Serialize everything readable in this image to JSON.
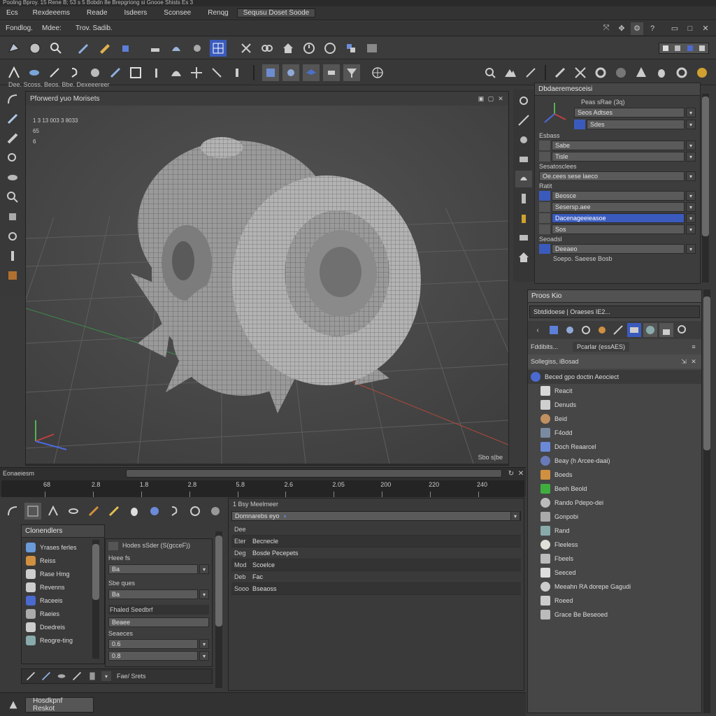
{
  "titlebar": {
    "text": "Pooling Bproy. 15 Rene B; 53 s 5 Bobdn 8e Brepgriong si Gnooe Shists Es 3"
  },
  "menubar": [
    "Ecs",
    "Rexdeeems",
    "Reade",
    "Isdeers",
    "Sconsee",
    "Renqg",
    "Sequsu Doset Soode"
  ],
  "breadcrumb": [
    "Fondlog.",
    "Mdee:",
    "Trov. Sadib."
  ],
  "toolbar_hint": "Dee. Scoss. Beos. Bbe. Dexeeereer",
  "viewport": {
    "title": "Pforwerd yuo Morisets",
    "stats": [
      "1 3 13 003 3 8033",
      "65",
      "6"
    ],
    "footer": "Sbo s|be"
  },
  "timeline": {
    "label": "Eonaeiesm",
    "ticks": [
      "68",
      "2.8",
      "1.8",
      "2.8",
      "5.8",
      "2.6",
      "2.05",
      "200",
      "220",
      "240"
    ]
  },
  "props_panel": {
    "title": "Dbdaeremesceisi",
    "header_label": "Peas sRae (3q)",
    "rows": [
      {
        "label": "Seos Adtses",
        "value": ""
      },
      {
        "label": "Sdes",
        "value": ""
      },
      {
        "label": "Esbass",
        "value": ""
      },
      {
        "label": "Sabe",
        "value": ""
      },
      {
        "label": "Tisle",
        "value": ""
      },
      {
        "label": "Sesatosclees",
        "value": ""
      },
      {
        "label": "Oe.cees sese laeco",
        "value": ""
      },
      {
        "label": "Ratit",
        "value": ""
      },
      {
        "label": "Beosce",
        "value": ""
      },
      {
        "label": "Sesersp.aee",
        "value": ""
      },
      {
        "label": "Dacenageeieasoe",
        "value": ""
      },
      {
        "label": "Sos",
        "value": ""
      },
      {
        "label": "Seoadsl",
        "value": ""
      },
      {
        "label": "Deeaeo",
        "value": ""
      },
      {
        "label": "Soepo. Saeese Bosb",
        "value": ""
      }
    ]
  },
  "outliner": {
    "title": "Proos Kio",
    "search": "Sbtdidoese | Oraeses IE2...",
    "tabs": [
      "Fddibits...",
      "Pcarlar (essAES)"
    ],
    "section": "Sollegiss, iBosad",
    "items": [
      "Beced gpo doctin Aeociect",
      "Reacit",
      "Denuds",
      "Beid",
      "F4odd",
      "Doch Reaarcel",
      "Beay (h Arcee-daai)",
      "Boeds",
      "Beeh Beold",
      "Rando Pdepo-dei",
      "Gonpobi",
      "Rand",
      "Fleeless",
      "Fbeels",
      "Seeced",
      "Meeahn RA dorepe Gagudi",
      "Roeed",
      "Grace Be Beseoed"
    ]
  },
  "anim_panel": {
    "title": "1 Bsy Meelmeer",
    "rows": [
      {
        "key": "Domnarebs eyo",
        "val": ""
      },
      {
        "key": "Dee",
        "val": ""
      },
      {
        "key": "Eter",
        "val": "Becnecle"
      },
      {
        "key": "Deg",
        "val": "Bosde Pecepets"
      },
      {
        "key": "Mod",
        "val": "Scoelce"
      },
      {
        "key": "Deb",
        "val": "Fac"
      },
      {
        "key": "Sooo",
        "val": "Bseaoss"
      }
    ]
  },
  "brushes": {
    "title": "Clonendlers",
    "items": [
      "Yrases ferles",
      "Reiss",
      "Rase Hmg",
      "Revenns",
      "Raceeis",
      "Raeies",
      "Doedreis",
      "Reogre-ting"
    ]
  },
  "attr": {
    "rows": [
      "Hodes sSder (S(gcceF))",
      "Heee fs",
      "Ba",
      "Sbe ques",
      "Ba",
      "Fhaled Seedbrf",
      "Beaee",
      "Seaeces",
      "0.6",
      "0.8"
    ],
    "footer": "Fae/ Srets"
  },
  "statusbar": {
    "button": "Hosdkpnf Reskot"
  },
  "colors": {
    "accent": "#3a5bbd",
    "grid": "#4b4b4b",
    "viewport_bg": "#4a4a4a"
  }
}
